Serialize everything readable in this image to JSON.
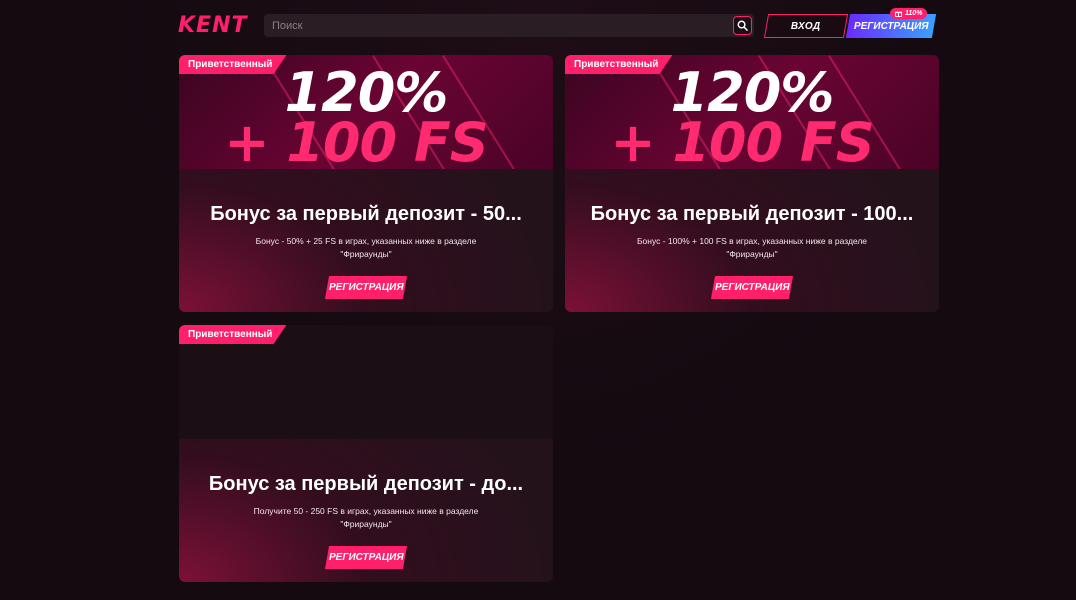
{
  "header": {
    "logo": "KENT",
    "search_placeholder": "Поиск",
    "login_label": "ВХОД",
    "register_label": "РЕГИСТРАЦИЯ",
    "register_badge": "110%"
  },
  "cards": [
    {
      "tag": "Приветственный",
      "hero_line1": "120%",
      "hero_line2": "+ 100 FS",
      "title": "Бонус за первый депозит - 50...",
      "description": "Бонус - 50% + 25 FS в играх, указанных ниже в разделе \"Фрираунды\"",
      "button": "РЕГИСТРАЦИЯ"
    },
    {
      "tag": "Приветственный",
      "hero_line1": "120%",
      "hero_line2": "+ 100 FS",
      "title": "Бонус за первый депозит - 100...",
      "description": "Бонус - 100% + 100 FS в играх, указанных ниже в разделе \"Фрираунды\"",
      "button": "РЕГИСТРАЦИЯ"
    },
    {
      "tag": "Приветственный",
      "title": "Бонус за первый депозит - до...",
      "description": "Получите 50 - 250 FS в играх, указанных ниже в разделе \"Фрираунды\"",
      "button": "РЕГИСТРАЦИЯ"
    }
  ],
  "colors": {
    "accent": "#ff1f6b",
    "background": "#140a10",
    "register_gradient_start": "#6a2bff",
    "register_gradient_end": "#3aa0ff"
  },
  "icons": {
    "search": "search-icon",
    "gift": "gift-icon"
  }
}
